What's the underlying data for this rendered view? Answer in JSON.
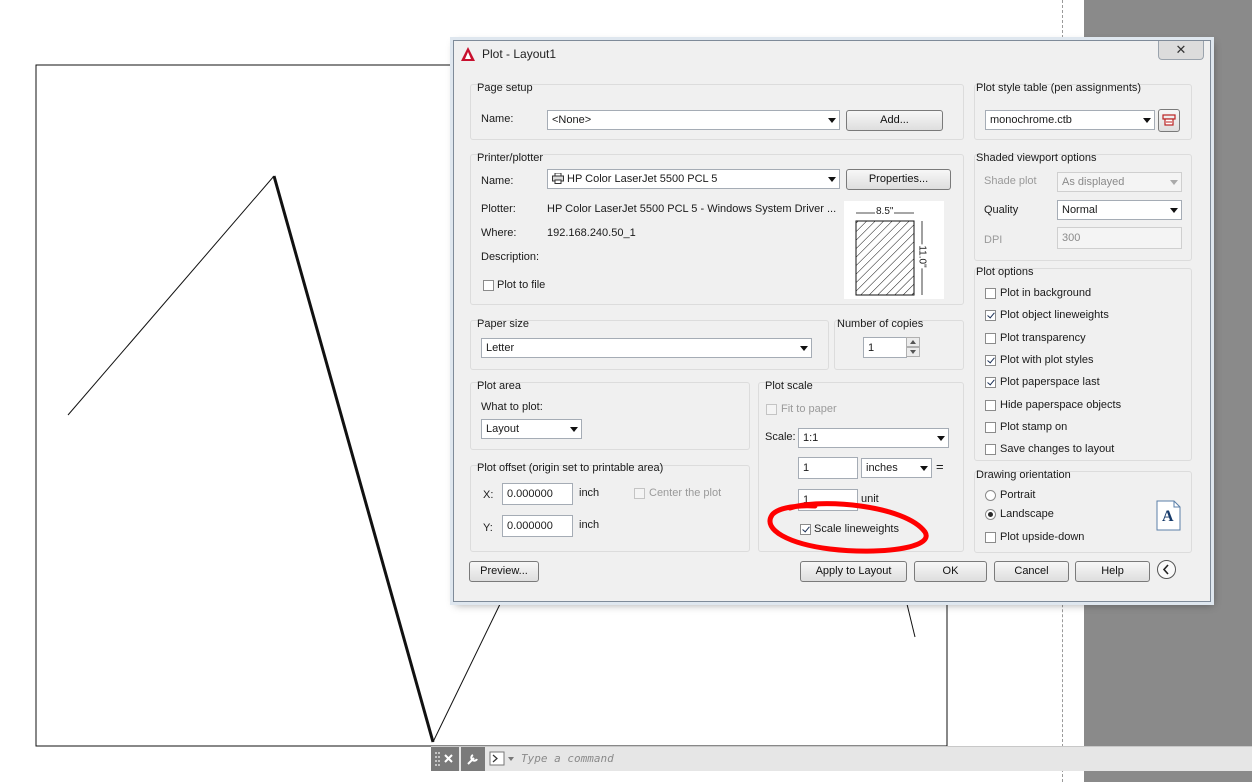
{
  "dialog": {
    "title": "Plot - Layout1",
    "close_glyph": "✕",
    "page_setup": {
      "group_label": "Page setup",
      "name_label": "Name:",
      "name_value": "<None>",
      "add_button": "Add..."
    },
    "printer": {
      "group_label": "Printer/plotter",
      "name_label": "Name:",
      "name_value": "HP Color LaserJet 5500 PCL 5",
      "properties_button": "Properties...",
      "plotter_label": "Plotter:",
      "plotter_value": "HP Color LaserJet 5500 PCL 5 - Windows System Driver ...",
      "where_label": "Where:",
      "where_value": "192.168.240.50_1",
      "description_label": "Description:",
      "plot_to_file_label": "Plot to file",
      "plot_to_file_checked": false,
      "paper_width_label": "8.5\"",
      "paper_height_label": "11.0\""
    },
    "paper_size": {
      "group_label": "Paper size",
      "value": "Letter"
    },
    "copies": {
      "group_label": "Number of copies",
      "value": "1"
    },
    "plot_area": {
      "group_label": "Plot area",
      "what_label": "What to plot:",
      "what_value": "Layout"
    },
    "plot_offset": {
      "group_label": "Plot offset (origin set to printable area)",
      "x_label": "X:",
      "x_value": "0.000000",
      "x_unit": "inch",
      "y_label": "Y:",
      "y_value": "0.000000",
      "y_unit": "inch",
      "center_label": "Center the plot"
    },
    "plot_scale": {
      "group_label": "Plot scale",
      "fit_label": "Fit to paper",
      "scale_label": "Scale:",
      "scale_value": "1:1",
      "value1": "1",
      "unit1": "inches",
      "equals": "=",
      "value2": "1",
      "unit2": "unit",
      "scale_lineweights_label": "Scale lineweights",
      "scale_lineweights_checked": true
    },
    "plot_style": {
      "group_label": "Plot style table (pen assignments)",
      "value": "monochrome.ctb"
    },
    "shaded": {
      "group_label": "Shaded viewport options",
      "shade_label": "Shade plot",
      "shade_value": "As displayed",
      "quality_label": "Quality",
      "quality_value": "Normal",
      "dpi_label": "DPI",
      "dpi_value": "300"
    },
    "plot_options": {
      "group_label": "Plot options",
      "items": [
        {
          "label": "Plot in background",
          "checked": false
        },
        {
          "label": "Plot object lineweights",
          "checked": true
        },
        {
          "label": "Plot transparency",
          "checked": false
        },
        {
          "label": "Plot with plot styles",
          "checked": true
        },
        {
          "label": "Plot paperspace last",
          "checked": true
        },
        {
          "label": "Hide paperspace objects",
          "checked": false
        },
        {
          "label": "Plot stamp on",
          "checked": false
        },
        {
          "label": "Save changes to layout",
          "checked": false
        }
      ]
    },
    "orientation": {
      "group_label": "Drawing orientation",
      "portrait": "Portrait",
      "landscape": "Landscape",
      "upside_down": "Plot upside-down",
      "selected": "Landscape",
      "icon_letter": "A"
    },
    "buttons": {
      "preview": "Preview...",
      "apply": "Apply to Layout",
      "ok": "OK",
      "cancel": "Cancel",
      "help": "Help"
    }
  },
  "command_line": {
    "placeholder": "Type a command"
  },
  "colors": {
    "annotation_circle": "#ff0000",
    "margin_gray": "#8a8a8a"
  }
}
